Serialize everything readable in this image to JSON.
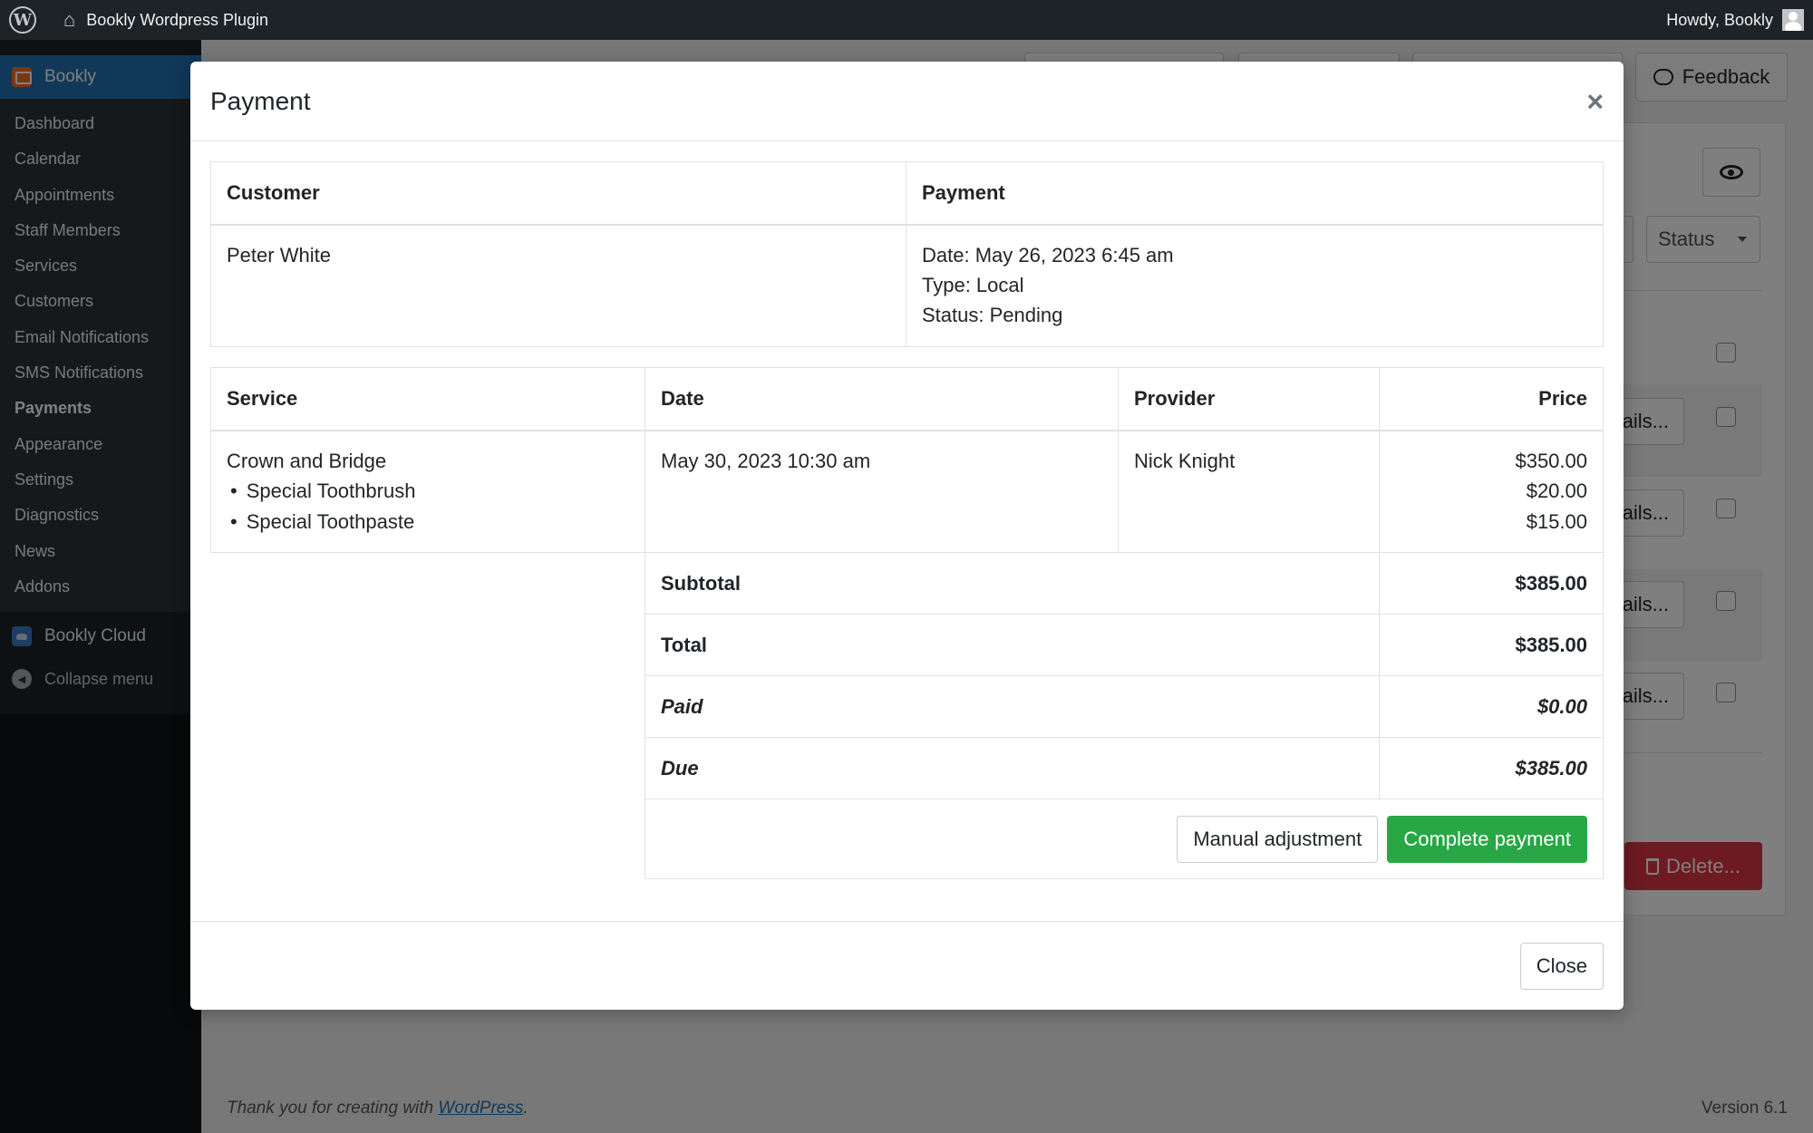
{
  "adminbar": {
    "site_name": "Bookly Wordpress Plugin",
    "howdy": "Howdy, Bookly"
  },
  "sidebar": {
    "top_item": "Bookly",
    "items": [
      "Dashboard",
      "Calendar",
      "Appointments",
      "Staff Members",
      "Services",
      "Customers",
      "Email Notifications",
      "SMS Notifications",
      "Payments",
      "Appearance",
      "Settings",
      "Diagnostics",
      "News",
      "Addons"
    ],
    "current": "Payments",
    "cloud": "Bookly Cloud",
    "collapse": "Collapse menu"
  },
  "background": {
    "feedback": "Feedback",
    "status_filter": "Status",
    "details_label": "ails...",
    "delete_label": "Delete...",
    "footer_text": "Thank you for creating with",
    "footer_link": "WordPress",
    "footer_period": ".",
    "version": "Version 6.1"
  },
  "modal": {
    "title": "Payment",
    "close_x": "×",
    "customer_header": "Customer",
    "payment_header": "Payment",
    "customer_name": "Peter White",
    "payment_date": "Date: May 26, 2023 6:45 am",
    "payment_type": "Type: Local",
    "payment_status": "Status: Pending",
    "columns": {
      "service": "Service",
      "date": "Date",
      "provider": "Provider",
      "price": "Price"
    },
    "service": "Crown and Bridge",
    "extras": [
      "Special Toothbrush",
      "Special Toothpaste"
    ],
    "date": "May 30, 2023 10:30 am",
    "provider": "Nick Knight",
    "prices": [
      "$350.00",
      "$20.00",
      "$15.00"
    ],
    "subtotal_label": "Subtotal",
    "subtotal": "$385.00",
    "total_label": "Total",
    "total": "$385.00",
    "paid_label": "Paid",
    "paid": "$0.00",
    "due_label": "Due",
    "due": "$385.00",
    "manual_adjustment": "Manual adjustment",
    "complete_payment": "Complete payment",
    "close_button": "Close"
  },
  "colors": {
    "accent": "#2271b1",
    "success": "#28a745",
    "danger": "#dc3545",
    "adminbar": "#1d2327"
  }
}
